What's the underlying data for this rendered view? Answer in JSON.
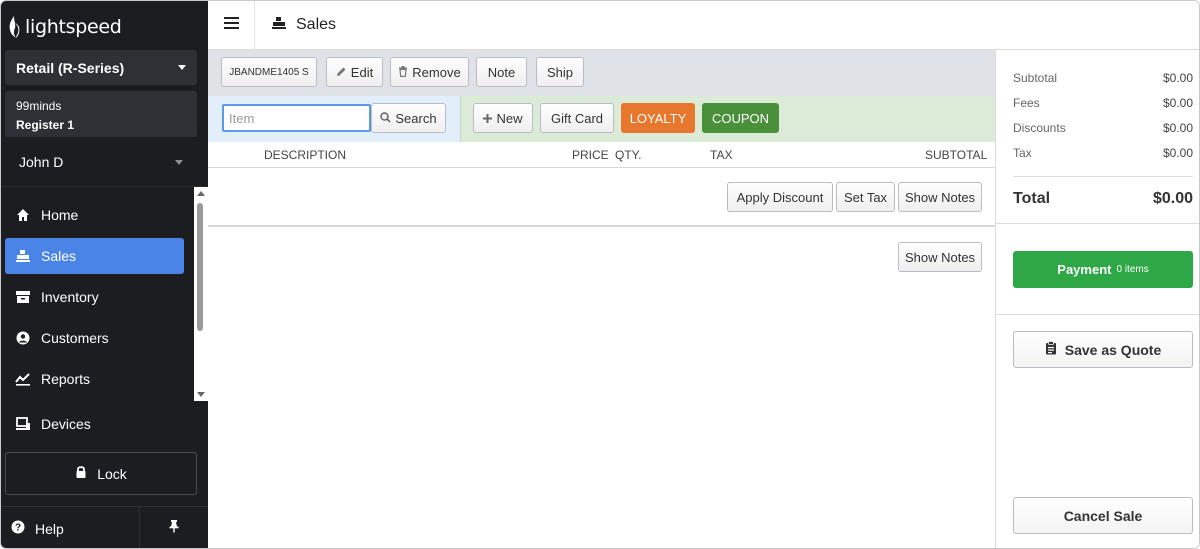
{
  "sidebar": {
    "logo_text": "lightspeed",
    "account": "Retail (R-Series)",
    "register_store": "99minds",
    "register_name": "Register 1",
    "user": "John D",
    "nav": [
      {
        "label": "Home",
        "icon": "home-icon"
      },
      {
        "label": "Sales",
        "icon": "register-icon"
      },
      {
        "label": "Inventory",
        "icon": "inventory-icon"
      },
      {
        "label": "Customers",
        "icon": "customer-icon"
      },
      {
        "label": "Reports",
        "icon": "chart-icon"
      },
      {
        "label": "Devices",
        "icon": "devices-icon"
      }
    ],
    "lock": "Lock",
    "help": "Help"
  },
  "header": {
    "title": "Sales"
  },
  "actions": {
    "sale_id": "JBANDME1405 S",
    "edit": "Edit",
    "remove": "Remove",
    "note": "Note",
    "ship": "Ship"
  },
  "search": {
    "placeholder": "Item",
    "button": "Search",
    "new": "New",
    "gift_card": "Gift Card",
    "loyalty": "LOYALTY",
    "coupon": "COUPON"
  },
  "table": {
    "columns": [
      "DESCRIPTION",
      "PRICE",
      "QTY.",
      "TAX",
      "SUBTOTAL"
    ],
    "apply_discount": "Apply Discount",
    "set_tax": "Set Tax",
    "show_notes": "Show Notes",
    "show_notes_2": "Show Notes"
  },
  "summary": {
    "rows": [
      {
        "label": "Subtotal",
        "value": "$0.00"
      },
      {
        "label": "Fees",
        "value": "$0.00"
      },
      {
        "label": "Discounts",
        "value": "$0.00"
      },
      {
        "label": "Tax",
        "value": "$0.00"
      }
    ],
    "total_label": "Total",
    "total_value": "$0.00",
    "payment": "Payment",
    "payment_count": "0 items",
    "save_quote": "Save as Quote",
    "cancel_sale": "Cancel Sale"
  },
  "colors": {
    "sidebar_bg": "#1b1d21",
    "active_nav": "#4a84e6",
    "loyalty": "#e8772e",
    "coupon": "#4a8f3a",
    "payment": "#2ea846"
  }
}
